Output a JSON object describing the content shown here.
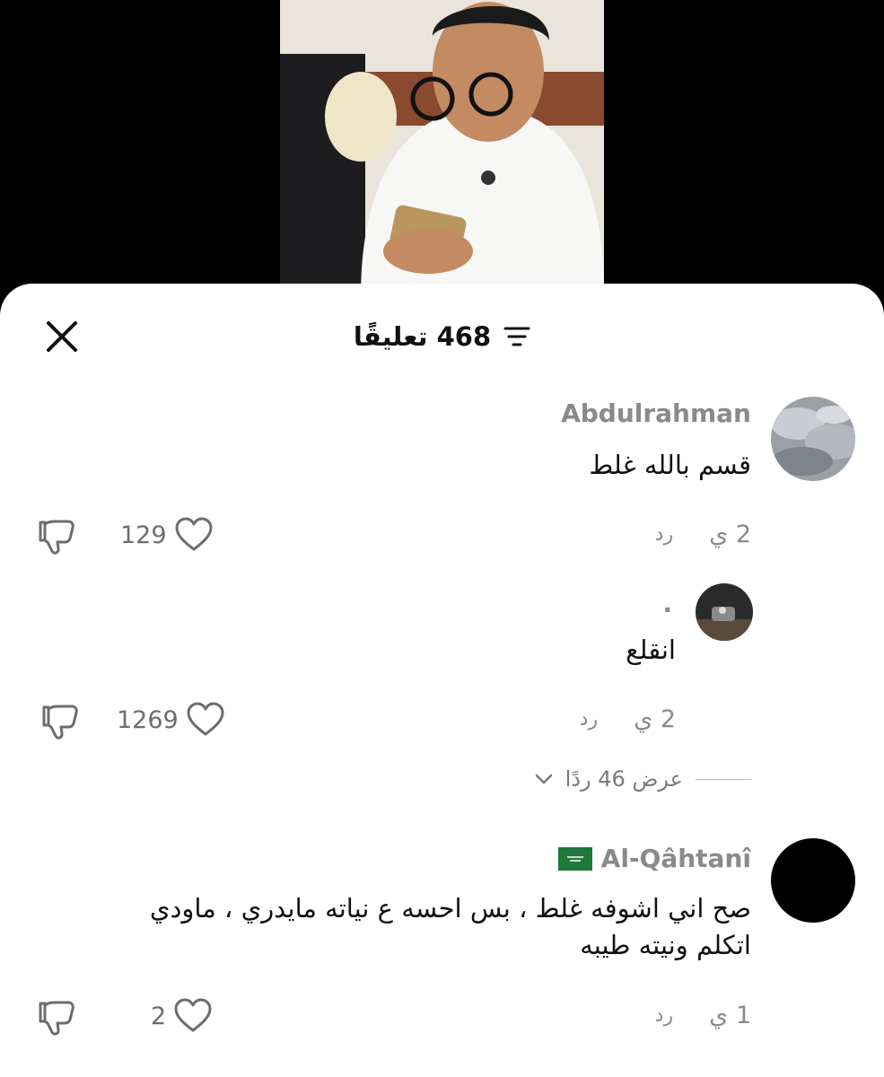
{
  "header": {
    "title": "468 تعليقًا",
    "close_icon": "close-icon",
    "filter_icon": "filter-icon"
  },
  "comments": [
    {
      "username": "Abdulrahman",
      "text": "قسم بالله غلط",
      "time": "2 ي",
      "reply_label": "رد",
      "likes": "129"
    },
    {
      "username": ".",
      "text": "انقلع",
      "time": "2 ي",
      "reply_label": "رد",
      "likes": "1269",
      "view_replies": "عرض 46 ردًا"
    },
    {
      "username": "Al-Qâhtanî",
      "text_line1": "صح اني اشوفه غلط ، بس احسه ع نياته مايدري ، ماودي",
      "text_line2": "اتكلم ونيته طيبه",
      "time": "1 ي",
      "reply_label": "رد",
      "likes": "2"
    }
  ],
  "colors": {
    "sheet": "#ffffff",
    "muted": "#8a8a8a",
    "text": "#111111"
  }
}
